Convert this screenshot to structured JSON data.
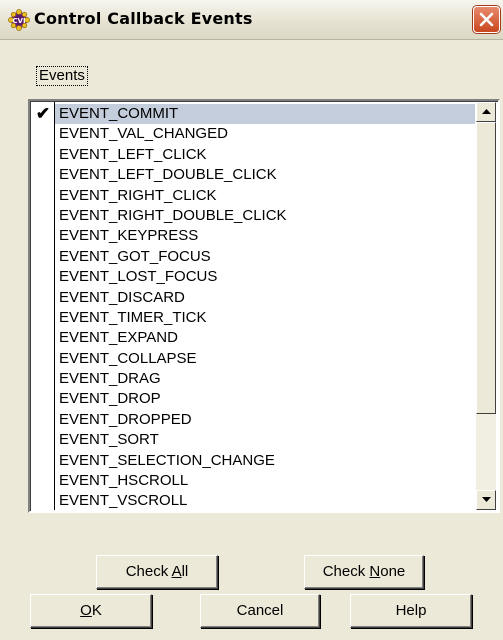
{
  "window": {
    "title": "Control Callback Events",
    "icon": "cvi-app-icon",
    "close": "close-icon"
  },
  "group": {
    "label": "Events"
  },
  "events": [
    {
      "label": "EVENT_COMMIT",
      "checked": true,
      "selected": true
    },
    {
      "label": "EVENT_VAL_CHANGED",
      "checked": false
    },
    {
      "label": "EVENT_LEFT_CLICK",
      "checked": false
    },
    {
      "label": "EVENT_LEFT_DOUBLE_CLICK",
      "checked": false
    },
    {
      "label": "EVENT_RIGHT_CLICK",
      "checked": false
    },
    {
      "label": "EVENT_RIGHT_DOUBLE_CLICK",
      "checked": false
    },
    {
      "label": "EVENT_KEYPRESS",
      "checked": false
    },
    {
      "label": "EVENT_GOT_FOCUS",
      "checked": false
    },
    {
      "label": "EVENT_LOST_FOCUS",
      "checked": false
    },
    {
      "label": "EVENT_DISCARD",
      "checked": false
    },
    {
      "label": "EVENT_TIMER_TICK",
      "checked": false
    },
    {
      "label": "EVENT_EXPAND",
      "checked": false
    },
    {
      "label": "EVENT_COLLAPSE",
      "checked": false
    },
    {
      "label": "EVENT_DRAG",
      "checked": false
    },
    {
      "label": "EVENT_DROP",
      "checked": false
    },
    {
      "label": "EVENT_DROPPED",
      "checked": false
    },
    {
      "label": "EVENT_SORT",
      "checked": false
    },
    {
      "label": "EVENT_SELECTION_CHANGE",
      "checked": false
    },
    {
      "label": "EVENT_HSCROLL",
      "checked": false
    },
    {
      "label": "EVENT_VSCROLL",
      "checked": false
    }
  ],
  "buttons": {
    "check_all": {
      "pre": "Check ",
      "accel": "A",
      "post": "ll"
    },
    "check_none": {
      "pre": "Check ",
      "accel": "N",
      "post": "one"
    },
    "ok": {
      "pre": "",
      "accel": "O",
      "post": "K"
    },
    "cancel": {
      "label": "Cancel"
    },
    "help": {
      "label": "Help"
    }
  },
  "colors": {
    "dialog_bg": "#ece9d8",
    "selection": "#c4cddc",
    "close_button": "#c9461e"
  }
}
